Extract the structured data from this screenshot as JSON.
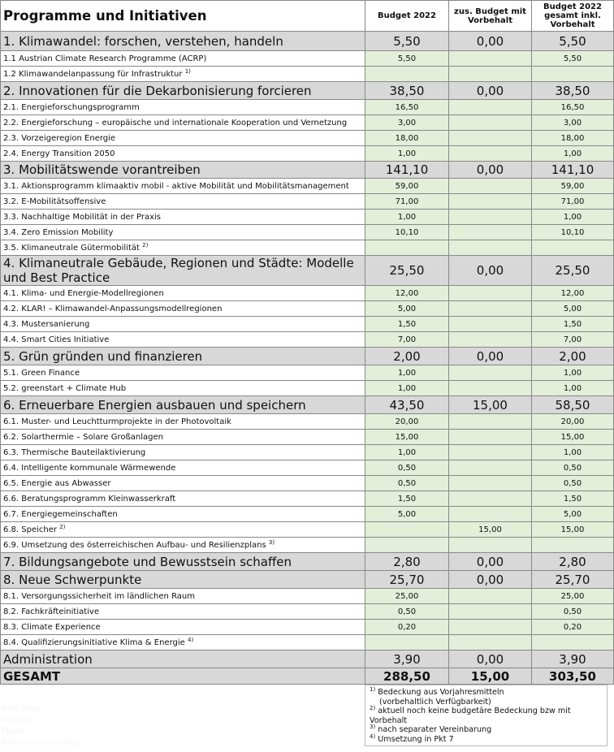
{
  "header": {
    "title": "Programme und Initiativen",
    "col_budget": "Budget 2022",
    "col_extra": "zus. Budget mit Vorbehalt",
    "col_total": "Budget 2022 gesamt inkl. Vorbehalt"
  },
  "rows": [
    {
      "type": "section",
      "label": "1. Klimawandel: forschen, verstehen, handeln",
      "budget": "5,50",
      "extra": "0,00",
      "total": "5,50",
      "h": 24
    },
    {
      "type": "item",
      "label": "1.1 Austrian Climate Research Programme (ACRP)",
      "budget": "5,50",
      "extra": "",
      "total": "5,50",
      "h": 19
    },
    {
      "type": "item",
      "label": "1.2 Klimawandelanpassung für Infrastruktur",
      "sup": "1)",
      "budget": "",
      "extra": "",
      "total": "",
      "h": 19
    },
    {
      "type": "section",
      "label": "2. Innovationen für die Dekarbonisierung forcieren",
      "budget": "38,50",
      "extra": "0,00",
      "total": "38,50",
      "h": 22
    },
    {
      "type": "item",
      "label": "2.1. Energieforschungsprogramm",
      "budget": "16,50",
      "extra": "",
      "total": "16,50",
      "h": 19
    },
    {
      "type": "item",
      "label": "2.2. Energieforschung – europäische und internationale Kooperation und Vernetzung",
      "budget": "3,00",
      "extra": "",
      "total": "3,00",
      "h": 19
    },
    {
      "type": "item",
      "label": "2.3. Vorzeigeregion Energie",
      "budget": "18,00",
      "extra": "",
      "total": "18,00",
      "h": 19
    },
    {
      "type": "item",
      "label": "2.4. Energy Transition 2050",
      "budget": "1,00",
      "extra": "",
      "total": "1,00",
      "h": 19
    },
    {
      "type": "section",
      "label": "3. Mobilitätswende vorantreiben",
      "budget": "141,10",
      "extra": "0,00",
      "total": "141,10",
      "h": 21
    },
    {
      "type": "item",
      "label": "3.1. Aktionsprogramm klimaaktiv mobil - aktive Mobilität und Mobilitätsmanagement",
      "budget": "59,00",
      "extra": "",
      "total": "59,00",
      "h": 19
    },
    {
      "type": "item",
      "label": "3.2. E-Mobilitätsoffensive",
      "budget": "71,00",
      "extra": "",
      "total": "71,00",
      "h": 19
    },
    {
      "type": "item",
      "label": "3.3. Nachhaltige Mobilität in der Praxis",
      "budget": "1,00",
      "extra": "",
      "total": "1,00",
      "h": 19
    },
    {
      "type": "item",
      "label": "3.4. Zero Emission Mobility",
      "budget": "10,10",
      "extra": "",
      "total": "10,10",
      "h": 19
    },
    {
      "type": "item",
      "label": "3.5. Klimaneutrale Gütermobilität",
      "sup": "2)",
      "budget": "",
      "extra": "",
      "total": "",
      "h": 19
    },
    {
      "type": "section",
      "label": "4. Klimaneutrale Gebäude, Regionen und Städte: Modelle und Best Practice",
      "budget": "25,50",
      "extra": "0,00",
      "total": "25,50",
      "h": 37
    },
    {
      "type": "item",
      "label": "4.1. Klima- und Energie-Modellregionen",
      "budget": "12,00",
      "extra": "",
      "total": "12,00",
      "h": 19
    },
    {
      "type": "item",
      "label": "4.2. KLAR! – Klimawandel-Anpassungsmodellregionen",
      "budget": "5,00",
      "extra": "",
      "total": "5,00",
      "h": 19
    },
    {
      "type": "item",
      "label": "4.3. Mustersanierung",
      "budget": "1,50",
      "extra": "",
      "total": "1,50",
      "h": 19
    },
    {
      "type": "item",
      "label": "4.4. Smart Cities Initiative",
      "budget": "7,00",
      "extra": "",
      "total": "7,00",
      "h": 19
    },
    {
      "type": "section",
      "label": "5. Grün gründen und finanzieren",
      "budget": "2,00",
      "extra": "0,00",
      "total": "2,00",
      "h": 22
    },
    {
      "type": "item",
      "label": "5.1. Green Finance",
      "budget": "1,00",
      "extra": "",
      "total": "1,00",
      "h": 19
    },
    {
      "type": "item",
      "label": "5.2. greenstart + Climate Hub",
      "budget": "1,00",
      "extra": "",
      "total": "1,00",
      "h": 19
    },
    {
      "type": "section",
      "label": "6. Erneuerbare Energien ausbauen und speichern",
      "budget": "43,50",
      "extra": "15,00",
      "total": "58,50",
      "h": 22
    },
    {
      "type": "item",
      "label": "6.1. Muster- und Leuchtturmprojekte in der Photovoltaik",
      "budget": "20,00",
      "extra": "",
      "total": "20,00",
      "h": 19
    },
    {
      "type": "item",
      "label": "6.2. Solarthermie – Solare Großanlagen",
      "budget": "15,00",
      "extra": "",
      "total": "15,00",
      "h": 19
    },
    {
      "type": "item",
      "label": "6.3. Thermische Bauteilaktivierung",
      "budget": "1,00",
      "extra": "",
      "total": "1,00",
      "h": 19
    },
    {
      "type": "item",
      "label": "6.4. Intelligente kommunale Wärmewende",
      "budget": "0,50",
      "extra": "",
      "total": "0,50",
      "h": 19
    },
    {
      "type": "item",
      "label": "6.5. Energie aus Abwasser",
      "budget": "0,50",
      "extra": "",
      "total": "0,50",
      "h": 19
    },
    {
      "type": "item",
      "label": "6.6. Beratungsprogramm Kleinwasserkraft",
      "budget": "1,50",
      "extra": "",
      "total": "1,50",
      "h": 19
    },
    {
      "type": "item",
      "label": "6.7. Energiegemeinschaften",
      "budget": "5,00",
      "extra": "",
      "total": "5,00",
      "h": 19
    },
    {
      "type": "item",
      "label": "6.8. Speicher",
      "sup": "2)",
      "budget": "",
      "extra": "15,00",
      "total": "15,00",
      "h": 19
    },
    {
      "type": "item",
      "label": "6.9. Umsetzung des österreichischen Aufbau- und Resilienzplans",
      "sup": "3)",
      "budget": "",
      "extra": "",
      "total": "",
      "h": 19
    },
    {
      "type": "section",
      "label": "7. Bildungsangebote und Bewusstsein schaffen",
      "budget": "2,80",
      "extra": "0,00",
      "total": "2,80",
      "h": 22
    },
    {
      "type": "section",
      "label": "8. Neue Schwerpunkte",
      "budget": "25,70",
      "extra": "0,00",
      "total": "25,70",
      "h": 22
    },
    {
      "type": "item",
      "label": "8.1. Versorgungssicherheit im ländlichen Raum",
      "budget": "25,00",
      "extra": "",
      "total": "25,00",
      "h": 19
    },
    {
      "type": "item",
      "label": "8.2. Fachkräfteinitiative",
      "budget": "0,50",
      "extra": "",
      "total": "0,50",
      "h": 19
    },
    {
      "type": "item",
      "label": "8.3. Climate Experience",
      "budget": "0,20",
      "extra": "",
      "total": "0,20",
      "h": 19
    },
    {
      "type": "item",
      "label": "8.4. Qualifizierungsinitiative Klima & Energie",
      "sup": "4)",
      "budget": "",
      "extra": "",
      "total": "",
      "h": 19
    },
    {
      "type": "section",
      "label": "Administration",
      "budget": "3,90",
      "extra": "0,00",
      "total": "3,90",
      "h": 22
    },
    {
      "type": "total",
      "label": "GESAMT",
      "budget": "288,50",
      "extra": "15,00",
      "total": "303,50",
      "h": 20
    }
  ],
  "footnotes": [
    {
      "mark": "1)",
      "text": "Bedeckung aus Vorjahresmitteln"
    },
    {
      "mark": "",
      "text": "(vorbehaltlich Verfügbarkeit)"
    },
    {
      "mark": "2)",
      "text": "aktuell noch keine budgetäre Bedeckung bzw mit Vorbehalt"
    },
    {
      "mark": "3)",
      "text": "nach separater Vereinbarung"
    },
    {
      "mark": "4)",
      "text": "Umsetzung in Pkt 7"
    }
  ],
  "legend": [
    "Forschung",
    "Verkehr",
    "Markt",
    "Bewusstseinsbildung"
  ]
}
